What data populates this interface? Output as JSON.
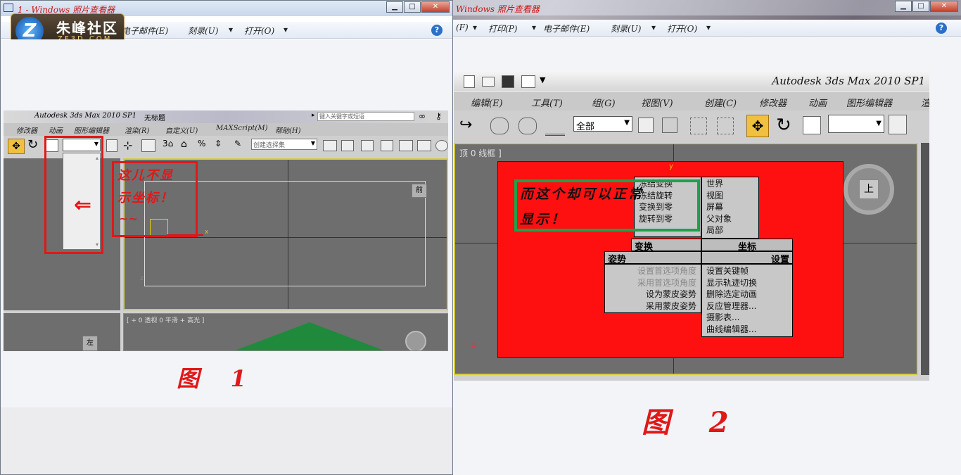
{
  "window1": {
    "title": "1 - Windows 照片查看器",
    "menus": [
      "电子邮件(E)",
      "刻录(U)",
      "打开(O)"
    ],
    "help": "?"
  },
  "window2": {
    "title": "Windows 照片查看器",
    "menus": [
      "(F)",
      "打印(P)",
      "电子邮件(E)",
      "刻录(U)",
      "打开(O)"
    ],
    "help": "?"
  },
  "logo": {
    "text": "朱峰社区",
    "sub": "ZF3D.COM",
    "letter": "Z"
  },
  "fig1": {
    "app_title": "Autodesk 3ds Max 2010 SP1",
    "doc_title": "无标题",
    "search_placeholder": "键入关键字或短语",
    "menus": [
      "修改器",
      "动画",
      "图形编辑器",
      "渲染(R)",
      "自定义(U)",
      "MAXScript(M)",
      "帮助(H)"
    ],
    "selection_set": "创建选择集",
    "viewport_label": "[ + 0 透视 0 平滑 + 高光 ]",
    "annotation": [
      "这儿不显",
      "示坐标！",
      "~~"
    ],
    "caption": "图    1",
    "cube_top": "前",
    "cube_left": "左"
  },
  "fig2": {
    "app_title": "Autodesk 3ds Max 2010 SP1",
    "menus": [
      "编辑(E)",
      "工具(T)",
      "组(G)",
      "视图(V)",
      "创建(C)",
      "修改器",
      "动画",
      "图形编辑器",
      "渲"
    ],
    "filter": "全部",
    "viewport_label": "顶 0 线框 ]",
    "annotation": [
      "而这个却可以正常",
      "显示！"
    ],
    "caption": "图    2",
    "cube_label": "上",
    "quad": {
      "transform_items": [
        "冻结变换",
        "冻结旋转",
        "变换到零",
        "旋转到零"
      ],
      "transform_head": "变换",
      "coord_items": [
        "世界",
        "视图",
        "屏幕",
        "父对象",
        "局部"
      ],
      "coord_head": "坐标",
      "pose_head": "姿势",
      "pose_items": [
        "设置首选项角度",
        "采用首选项角度",
        "设为蒙皮姿势",
        "采用蒙皮姿势"
      ],
      "settings_head": "设置",
      "settings_items": [
        "设置关键帧",
        "显示轨迹切换",
        "删除选定动画",
        "反应管理器...",
        "摄影表...",
        "曲线编辑器..."
      ]
    }
  }
}
